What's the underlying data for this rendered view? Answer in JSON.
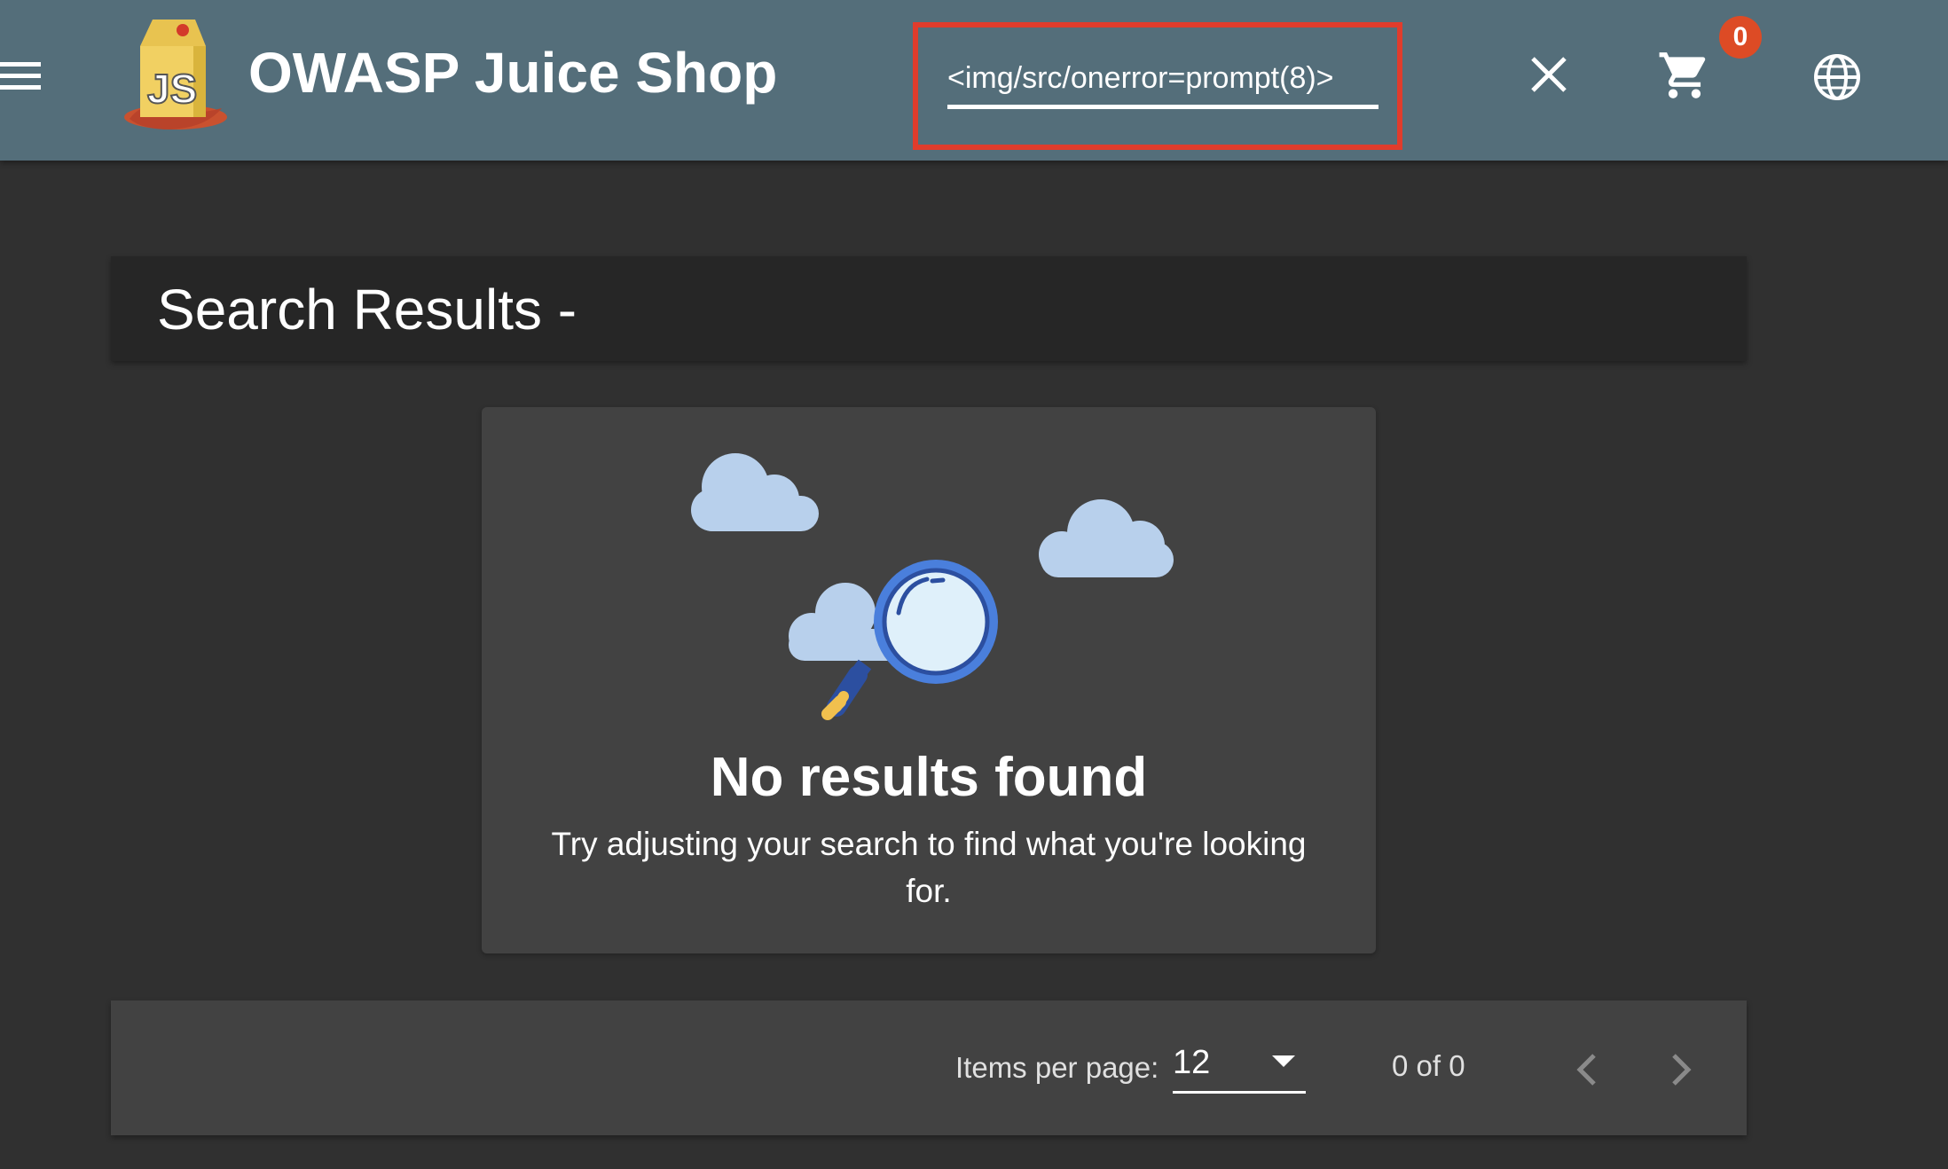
{
  "app": {
    "title": "OWASP Juice Shop"
  },
  "toolbar": {
    "menu_icon": "menu-icon",
    "logo_icon": "juice-carton-logo",
    "close_icon": "close-icon",
    "cart_icon": "shopping-cart-icon",
    "cart_count": "0",
    "language_icon": "globe-icon"
  },
  "search": {
    "value": "<img/src/onerror=prompt(8)>"
  },
  "results": {
    "title": "Search Results -"
  },
  "empty_state": {
    "illustration_icon": "magnifier-clouds-illustration",
    "title": "No results found",
    "message": "Try adjusting your search to find what you're looking for."
  },
  "paginator": {
    "items_per_page_label": "Items per page:",
    "items_per_page_value": "12",
    "range_label": "0 of 0",
    "prev_icon": "chevron-left-icon",
    "next_icon": "chevron-right-icon"
  },
  "colors": {
    "toolbar": "#546e7a",
    "background": "#303030",
    "card": "#424242",
    "badge": "#dd4b25",
    "highlight": "#e03c2c"
  }
}
